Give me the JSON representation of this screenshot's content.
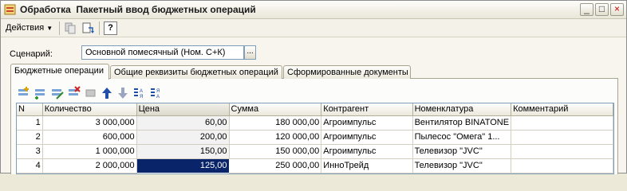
{
  "window": {
    "title": "Обработка  Пакетный ввод бюджетных операций",
    "minimize": "_",
    "maximize": "□",
    "close": "×"
  },
  "toolbar": {
    "actions_label": "Действия",
    "help_label": "?"
  },
  "scenario": {
    "label": "Сценарий:",
    "value": "Основной помесячный (Ном. С+К)",
    "select_button": "..."
  },
  "tabs": [
    {
      "label": "Бюджетные операции",
      "active": true
    },
    {
      "label": "Общие реквизиты бюджетных операций",
      "active": false
    },
    {
      "label": "Сформированные документы",
      "active": false
    }
  ],
  "table": {
    "columns": [
      "N",
      "Количество",
      "Цена",
      "Сумма",
      "Контрагент",
      "Номенклатура",
      "Комментарий"
    ],
    "rows": [
      {
        "n": "1",
        "qty": "3 000,000",
        "price": "60,00",
        "sum": "180 000,00",
        "contractor": "Агроимпульс",
        "item": "Вентилятор BINATONE",
        "comment": ""
      },
      {
        "n": "2",
        "qty": "600,000",
        "price": "200,00",
        "sum": "120 000,00",
        "contractor": "Агроимпульс",
        "item": "Пылесос \"Омега\" 1...",
        "comment": ""
      },
      {
        "n": "3",
        "qty": "1 000,000",
        "price": "150,00",
        "sum": "150 000,00",
        "contractor": "Агроимпульс",
        "item": "Телевизор \"JVC\"",
        "comment": ""
      },
      {
        "n": "4",
        "qty": "2 000,000",
        "price": "125,00",
        "sum": "250 000,00",
        "contractor": "ИнноТрейд",
        "item": "Телевизор \"JVC\"",
        "comment": ""
      }
    ]
  },
  "colors": {
    "selection": "#0a246a",
    "window_bg": "#f7f5ee"
  }
}
